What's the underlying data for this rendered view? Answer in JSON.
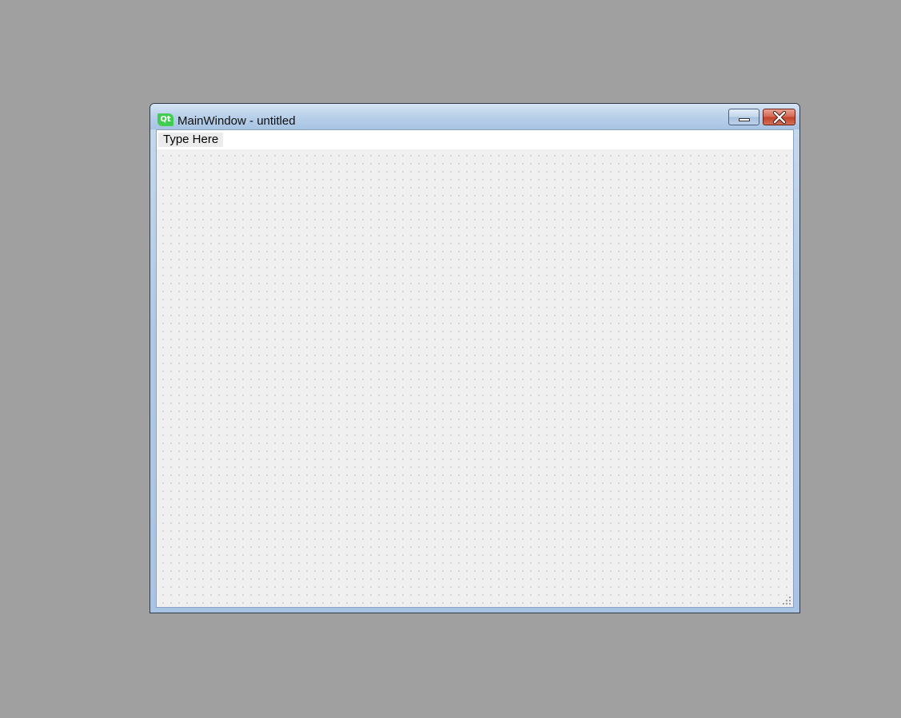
{
  "window": {
    "title": "MainWindow - untitled",
    "app_icon": "qt-logo-icon",
    "app_icon_text": "Qt",
    "controls": {
      "minimize_icon": "minimize-icon",
      "close_icon": "close-icon"
    }
  },
  "menubar": {
    "placeholder_item": "Type Here"
  },
  "colors": {
    "desktop_background": "#a0a0a0",
    "qt_green": "#41cd52",
    "close_red": "#c2432b",
    "titlebar_blue": "#b9d0ea",
    "form_background": "#f0f0f0"
  }
}
